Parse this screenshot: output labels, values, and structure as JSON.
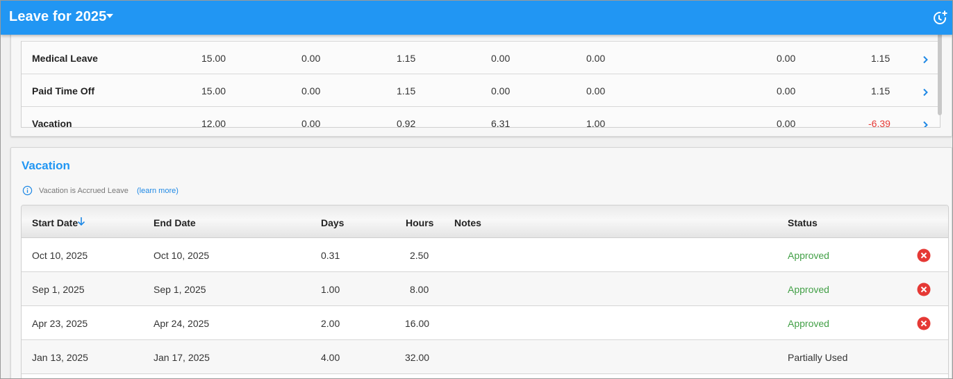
{
  "appbar": {
    "title": "Leave for 2025",
    "caret_icon": "caret-down-icon",
    "history_icon": "history-add-icon"
  },
  "colors": {
    "primary": "#2196f3",
    "approved": "#43a047",
    "negative": "#e53935",
    "delete": "#e53935"
  },
  "summary": {
    "rows": [
      {
        "name": "Medical Leave",
        "v1": "15.00",
        "v2": "0.00",
        "v3": "1.15",
        "v4": "0.00",
        "v5": "0.00",
        "v6": "0.00",
        "v7": "1.15"
      },
      {
        "name": "Paid Time Off",
        "v1": "15.00",
        "v2": "0.00",
        "v3": "1.15",
        "v4": "0.00",
        "v5": "0.00",
        "v6": "0.00",
        "v7": "1.15"
      },
      {
        "name": "Vacation",
        "v1": "12.00",
        "v2": "0.00",
        "v3": "0.92",
        "v4": "6.31",
        "v5": "1.00",
        "v6": "0.00",
        "v7": "-6.39"
      }
    ]
  },
  "vacation": {
    "heading": "Vacation",
    "info_text": "Vacation is Accrued Leave",
    "learn_more": "(learn more)",
    "columns": {
      "start": "Start Date",
      "end": "End Date",
      "days": "Days",
      "hours": "Hours",
      "notes": "Notes",
      "status": "Status"
    },
    "rows": [
      {
        "start": "Oct 10, 2025",
        "end": "Oct 10, 2025",
        "days": "0.31",
        "hours": "2.50",
        "notes": "",
        "status": "Approved",
        "deletable": true
      },
      {
        "start": "Sep 1, 2025",
        "end": "Sep 1, 2025",
        "days": "1.00",
        "hours": "8.00",
        "notes": "",
        "status": "Approved",
        "deletable": true
      },
      {
        "start": "Apr 23, 2025",
        "end": "Apr 24, 2025",
        "days": "2.00",
        "hours": "16.00",
        "notes": "",
        "status": "Approved",
        "deletable": true
      },
      {
        "start": "Jan 13, 2025",
        "end": "Jan 17, 2025",
        "days": "4.00",
        "hours": "32.00",
        "notes": "",
        "status": "Partially Used",
        "deletable": false
      }
    ]
  }
}
